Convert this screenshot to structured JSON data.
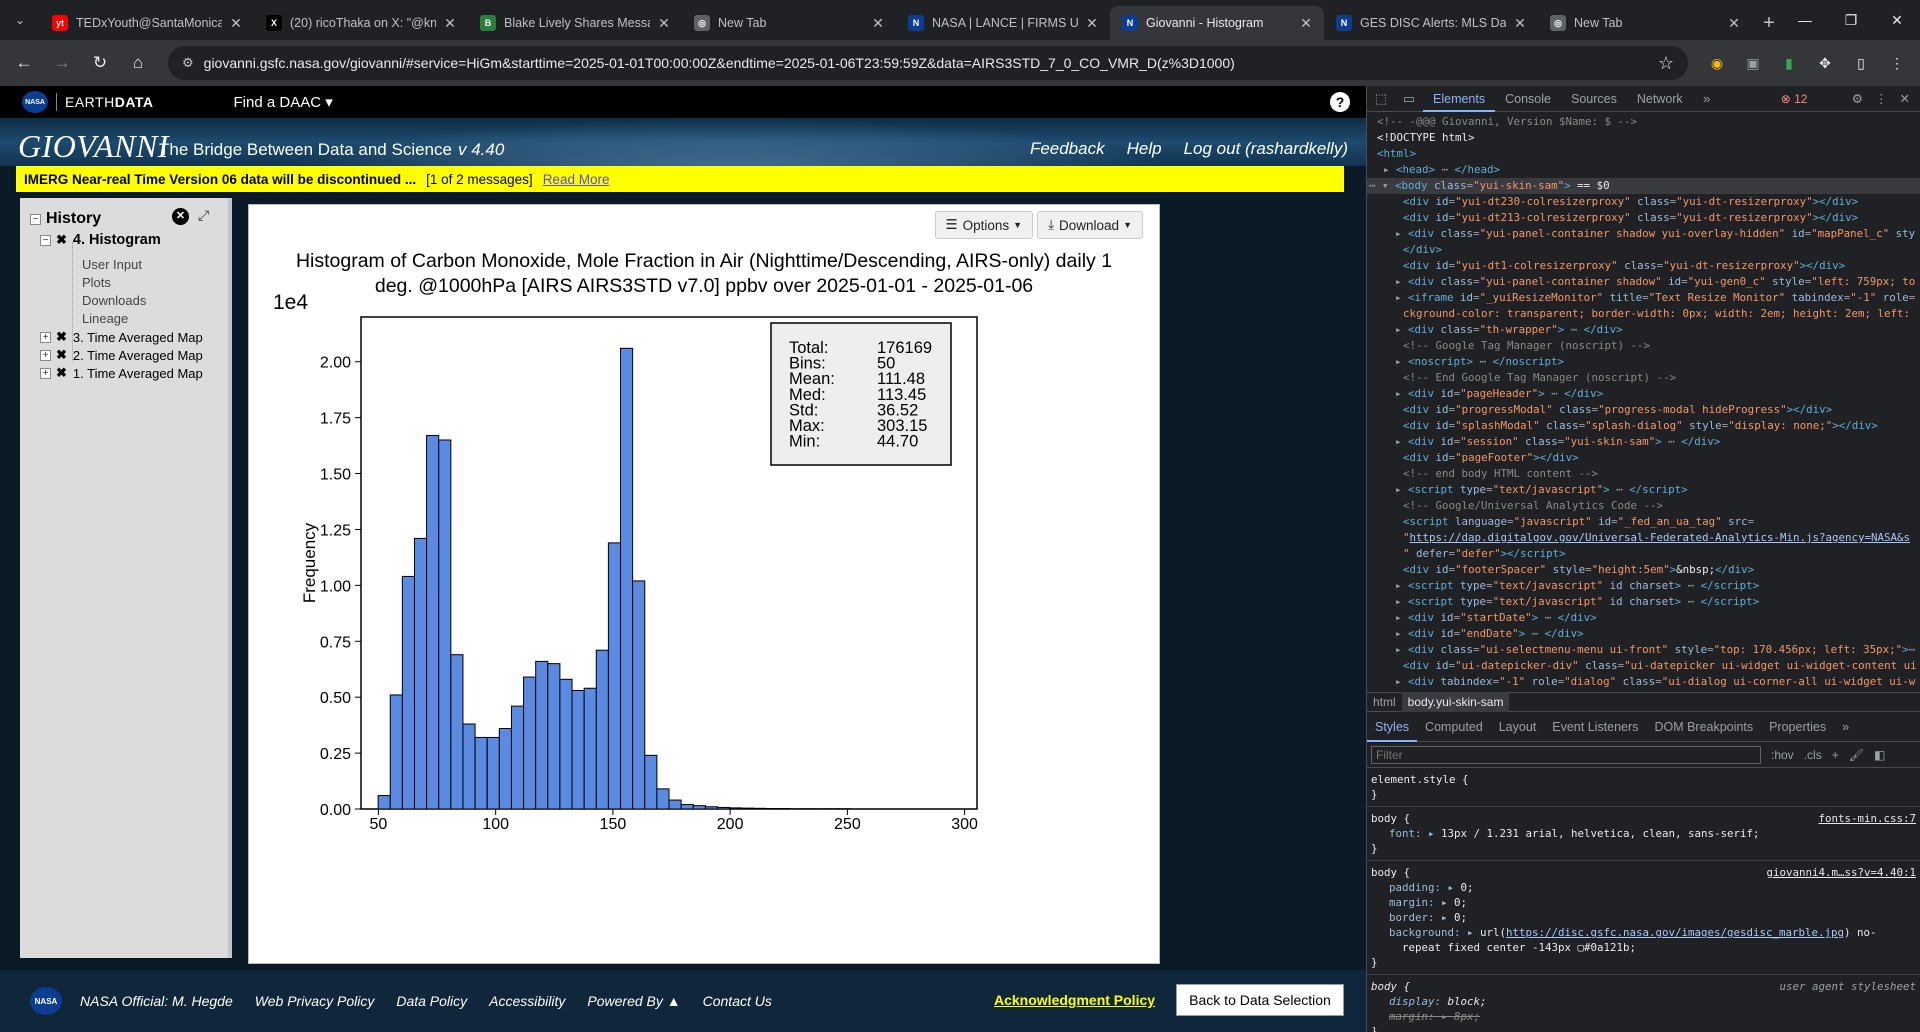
{
  "browser": {
    "tabs": [
      {
        "title": "TEDxYouth@SantaMonica",
        "fav": "yt",
        "color": "#ff0000"
      },
      {
        "title": "(20) ricoThaka on X: \"@kn",
        "fav": "X",
        "color": "#000000"
      },
      {
        "title": "Blake Lively Shares Messa",
        "fav": "B",
        "color": "#2a7f3f"
      },
      {
        "title": "New Tab",
        "fav": "◎",
        "color": "#5f6368"
      },
      {
        "title": "NASA | LANCE | FIRMS US",
        "fav": "N",
        "color": "#0b3d91"
      },
      {
        "title": "Giovanni - Histogram",
        "fav": "N",
        "color": "#0b3d91",
        "active": true
      },
      {
        "title": "GES DISC Alerts: MLS Data",
        "fav": "N",
        "color": "#0b3d91"
      },
      {
        "title": "New Tab",
        "fav": "◎",
        "color": "#5f6368"
      }
    ],
    "url": "giovanni.gsfc.nasa.gov/giovanni/#service=HiGm&starttime=2025-01-01T00:00:00Z&endtime=2025-01-06T23:59:59Z&data=AIRS3STD_7_0_CO_VMR_D(z%3D1000)"
  },
  "earthdata": {
    "logo_prefix": "EARTH",
    "logo_bold": "DATA",
    "find_daac": "Find a DAAC ▾",
    "help": "?"
  },
  "giovanni": {
    "title": "GIOVANNI",
    "subtitle": "The Bridge Between Data and Science",
    "version": "v 4.40",
    "links": [
      "Feedback",
      "Help",
      "Log out (rashardkelly)"
    ]
  },
  "banner": {
    "message": "IMERG Near-real Time Version 06 data will be discontinued ...",
    "count": "[1 of 2 messages]",
    "read_more": "Read More"
  },
  "history": {
    "title": "History",
    "current": "4. Histogram",
    "subitems": [
      "User Input",
      "Plots",
      "Downloads",
      "Lineage"
    ],
    "items": [
      "3. Time Averaged Map",
      "2. Time Averaged Map",
      "1. Time Averaged Map"
    ]
  },
  "plot": {
    "options_label": "Options",
    "download_label": "Download",
    "title_line1": "Histogram of Carbon Monoxide, Mole Fraction in Air (Nighttime/Descending, AIRS-only) daily 1",
    "title_line2": "deg. @1000hPa [AIRS AIRS3STD v7.0] ppbv over 2025-01-01 - 2025-01-06"
  },
  "chart_data": {
    "type": "bar",
    "title": "Histogram of Carbon Monoxide, Mole Fraction in Air (Nighttime/Descending, AIRS-only) daily 1 deg. @1000hPa [AIRS AIRS3STD v7.0] ppbv over 2025-01-01 - 2025-01-06",
    "xlabel": "",
    "ylabel": "Frequency",
    "y_scale_label": "1e4",
    "xlim": [
      44.7,
      303.15
    ],
    "ylim": [
      0,
      2.2
    ],
    "xticks": [
      50,
      100,
      150,
      200,
      250,
      300
    ],
    "yticks": [
      0.0,
      0.25,
      0.5,
      0.75,
      1.0,
      1.25,
      1.5,
      1.75,
      2.0
    ],
    "ytick_labels": [
      "0.00",
      "0.25",
      "0.50",
      "0.75",
      "1.00",
      "1.25",
      "1.50",
      "1.75",
      "2.00"
    ],
    "bin_start": 44.7,
    "bin_width": 5.169,
    "values": [
      0.0,
      0.06,
      0.51,
      1.04,
      1.21,
      1.67,
      1.65,
      0.69,
      0.38,
      0.32,
      0.32,
      0.36,
      0.46,
      0.59,
      0.66,
      0.65,
      0.58,
      0.53,
      0.54,
      0.71,
      1.19,
      2.06,
      1.02,
      0.24,
      0.09,
      0.04,
      0.02,
      0.015,
      0.01,
      0.007,
      0.005,
      0.004,
      0.003,
      0.002,
      0.002,
      0.001,
      0.001,
      0.001,
      0.001,
      0.001,
      0.0,
      0.0,
      0.0,
      0.0,
      0.0,
      0.0,
      0.0,
      0.0,
      0.0,
      0.0
    ],
    "bar_color": "#5a8be0",
    "grid": false,
    "stats_box": [
      {
        "label": "Total:",
        "value": "176169"
      },
      {
        "label": "Bins:",
        "value": "50"
      },
      {
        "label": "Mean:",
        "value": "111.48"
      },
      {
        "label": "Med:",
        "value": "113.45"
      },
      {
        "label": "Std:",
        "value": "36.52"
      },
      {
        "label": "Max:",
        "value": "303.15"
      },
      {
        "label": "Min:",
        "value": "44.70"
      }
    ]
  },
  "footer": {
    "links": [
      "NASA Official: M. Hegde",
      "Web Privacy Policy",
      "Data Policy",
      "Accessibility",
      "Powered By ▲",
      "Contact Us"
    ],
    "ack": "Acknowledgment Policy",
    "back": "Back to Data Selection"
  },
  "devtools": {
    "tabs": [
      "Elements",
      "Console",
      "Sources",
      "Network"
    ],
    "errors": "12",
    "crumbs": [
      "html",
      "body.yui-skin-sam"
    ],
    "style_tabs": [
      "Styles",
      "Computed",
      "Layout",
      "Event Listeners",
      "DOM Breakpoints",
      "Properties"
    ],
    "filter_placeholder": "Filter",
    "filter_opts": [
      ":hov",
      ".cls"
    ]
  }
}
